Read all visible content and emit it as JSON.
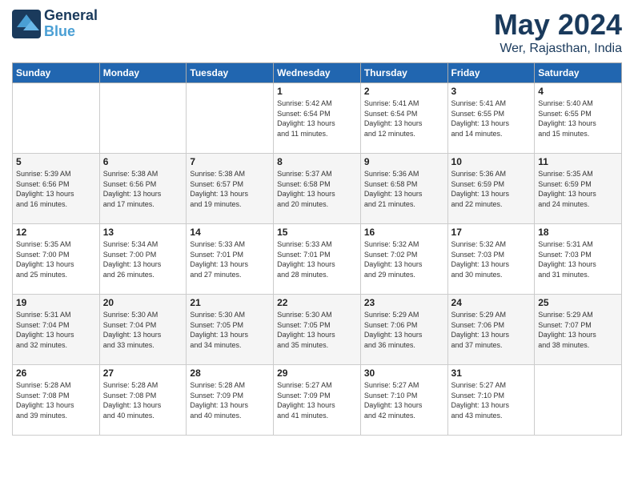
{
  "header": {
    "logo_line1": "General",
    "logo_line2": "Blue",
    "month_year": "May 2024",
    "location": "Wer, Rajasthan, India"
  },
  "days_of_week": [
    "Sunday",
    "Monday",
    "Tuesday",
    "Wednesday",
    "Thursday",
    "Friday",
    "Saturday"
  ],
  "weeks": [
    [
      {
        "day": "",
        "info": ""
      },
      {
        "day": "",
        "info": ""
      },
      {
        "day": "",
        "info": ""
      },
      {
        "day": "1",
        "info": "Sunrise: 5:42 AM\nSunset: 6:54 PM\nDaylight: 13 hours\nand 11 minutes."
      },
      {
        "day": "2",
        "info": "Sunrise: 5:41 AM\nSunset: 6:54 PM\nDaylight: 13 hours\nand 12 minutes."
      },
      {
        "day": "3",
        "info": "Sunrise: 5:41 AM\nSunset: 6:55 PM\nDaylight: 13 hours\nand 14 minutes."
      },
      {
        "day": "4",
        "info": "Sunrise: 5:40 AM\nSunset: 6:55 PM\nDaylight: 13 hours\nand 15 minutes."
      }
    ],
    [
      {
        "day": "5",
        "info": "Sunrise: 5:39 AM\nSunset: 6:56 PM\nDaylight: 13 hours\nand 16 minutes."
      },
      {
        "day": "6",
        "info": "Sunrise: 5:38 AM\nSunset: 6:56 PM\nDaylight: 13 hours\nand 17 minutes."
      },
      {
        "day": "7",
        "info": "Sunrise: 5:38 AM\nSunset: 6:57 PM\nDaylight: 13 hours\nand 19 minutes."
      },
      {
        "day": "8",
        "info": "Sunrise: 5:37 AM\nSunset: 6:58 PM\nDaylight: 13 hours\nand 20 minutes."
      },
      {
        "day": "9",
        "info": "Sunrise: 5:36 AM\nSunset: 6:58 PM\nDaylight: 13 hours\nand 21 minutes."
      },
      {
        "day": "10",
        "info": "Sunrise: 5:36 AM\nSunset: 6:59 PM\nDaylight: 13 hours\nand 22 minutes."
      },
      {
        "day": "11",
        "info": "Sunrise: 5:35 AM\nSunset: 6:59 PM\nDaylight: 13 hours\nand 24 minutes."
      }
    ],
    [
      {
        "day": "12",
        "info": "Sunrise: 5:35 AM\nSunset: 7:00 PM\nDaylight: 13 hours\nand 25 minutes."
      },
      {
        "day": "13",
        "info": "Sunrise: 5:34 AM\nSunset: 7:00 PM\nDaylight: 13 hours\nand 26 minutes."
      },
      {
        "day": "14",
        "info": "Sunrise: 5:33 AM\nSunset: 7:01 PM\nDaylight: 13 hours\nand 27 minutes."
      },
      {
        "day": "15",
        "info": "Sunrise: 5:33 AM\nSunset: 7:01 PM\nDaylight: 13 hours\nand 28 minutes."
      },
      {
        "day": "16",
        "info": "Sunrise: 5:32 AM\nSunset: 7:02 PM\nDaylight: 13 hours\nand 29 minutes."
      },
      {
        "day": "17",
        "info": "Sunrise: 5:32 AM\nSunset: 7:03 PM\nDaylight: 13 hours\nand 30 minutes."
      },
      {
        "day": "18",
        "info": "Sunrise: 5:31 AM\nSunset: 7:03 PM\nDaylight: 13 hours\nand 31 minutes."
      }
    ],
    [
      {
        "day": "19",
        "info": "Sunrise: 5:31 AM\nSunset: 7:04 PM\nDaylight: 13 hours\nand 32 minutes."
      },
      {
        "day": "20",
        "info": "Sunrise: 5:30 AM\nSunset: 7:04 PM\nDaylight: 13 hours\nand 33 minutes."
      },
      {
        "day": "21",
        "info": "Sunrise: 5:30 AM\nSunset: 7:05 PM\nDaylight: 13 hours\nand 34 minutes."
      },
      {
        "day": "22",
        "info": "Sunrise: 5:30 AM\nSunset: 7:05 PM\nDaylight: 13 hours\nand 35 minutes."
      },
      {
        "day": "23",
        "info": "Sunrise: 5:29 AM\nSunset: 7:06 PM\nDaylight: 13 hours\nand 36 minutes."
      },
      {
        "day": "24",
        "info": "Sunrise: 5:29 AM\nSunset: 7:06 PM\nDaylight: 13 hours\nand 37 minutes."
      },
      {
        "day": "25",
        "info": "Sunrise: 5:29 AM\nSunset: 7:07 PM\nDaylight: 13 hours\nand 38 minutes."
      }
    ],
    [
      {
        "day": "26",
        "info": "Sunrise: 5:28 AM\nSunset: 7:08 PM\nDaylight: 13 hours\nand 39 minutes."
      },
      {
        "day": "27",
        "info": "Sunrise: 5:28 AM\nSunset: 7:08 PM\nDaylight: 13 hours\nand 40 minutes."
      },
      {
        "day": "28",
        "info": "Sunrise: 5:28 AM\nSunset: 7:09 PM\nDaylight: 13 hours\nand 40 minutes."
      },
      {
        "day": "29",
        "info": "Sunrise: 5:27 AM\nSunset: 7:09 PM\nDaylight: 13 hours\nand 41 minutes."
      },
      {
        "day": "30",
        "info": "Sunrise: 5:27 AM\nSunset: 7:10 PM\nDaylight: 13 hours\nand 42 minutes."
      },
      {
        "day": "31",
        "info": "Sunrise: 5:27 AM\nSunset: 7:10 PM\nDaylight: 13 hours\nand 43 minutes."
      },
      {
        "day": "",
        "info": ""
      }
    ]
  ]
}
